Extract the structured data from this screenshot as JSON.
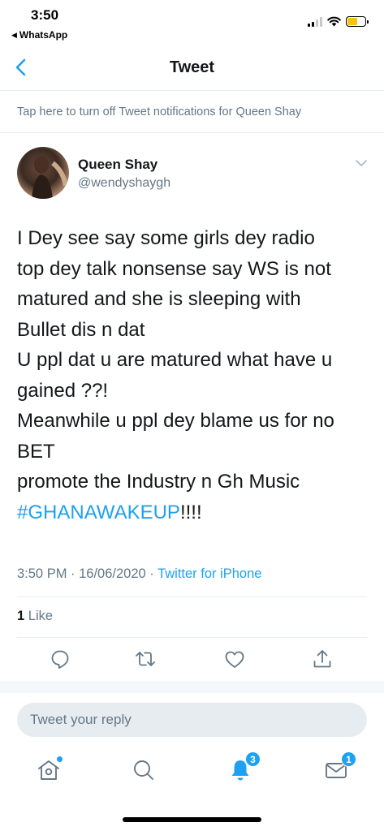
{
  "status_bar": {
    "time": "3:50",
    "back_app": "WhatsApp"
  },
  "nav": {
    "title": "Tweet",
    "back_icon": "chevron-left-icon"
  },
  "notification_bar": {
    "text": "Tap here to turn off Tweet notifications for Queen Shay"
  },
  "tweet": {
    "author_name": "Queen Shay",
    "author_handle": "@wendyshaygh",
    "lines": [
      "I Dey see say some girls dey radio",
      "top dey talk nonsense say WS is not",
      "matured and she is sleeping with",
      "Bullet dis n dat",
      "U ppl dat u are matured what have u",
      "gained ??!",
      "Meanwhile u ppl dey blame us for no",
      "BET",
      "promote the Industry n Gh Music"
    ],
    "hashtag": "#GHANAWAKEUP",
    "hashtag_suffix": "!!!!",
    "timestamp": "3:50 PM · 16/06/2020 · ",
    "source": "Twitter for iPhone",
    "like_count": "1",
    "like_label": " Like"
  },
  "actions": {
    "icons": [
      "reply-icon",
      "retweet-icon",
      "like-icon",
      "share-icon"
    ]
  },
  "reply": {
    "placeholder": "Tweet your reply"
  },
  "tabbar": {
    "notifications_badge": "3",
    "messages_badge": "1"
  },
  "colors": {
    "accent": "#1da1f2",
    "secondary_text": "#657786",
    "divider": "#e6ecf0",
    "battery": "#f7c600"
  }
}
